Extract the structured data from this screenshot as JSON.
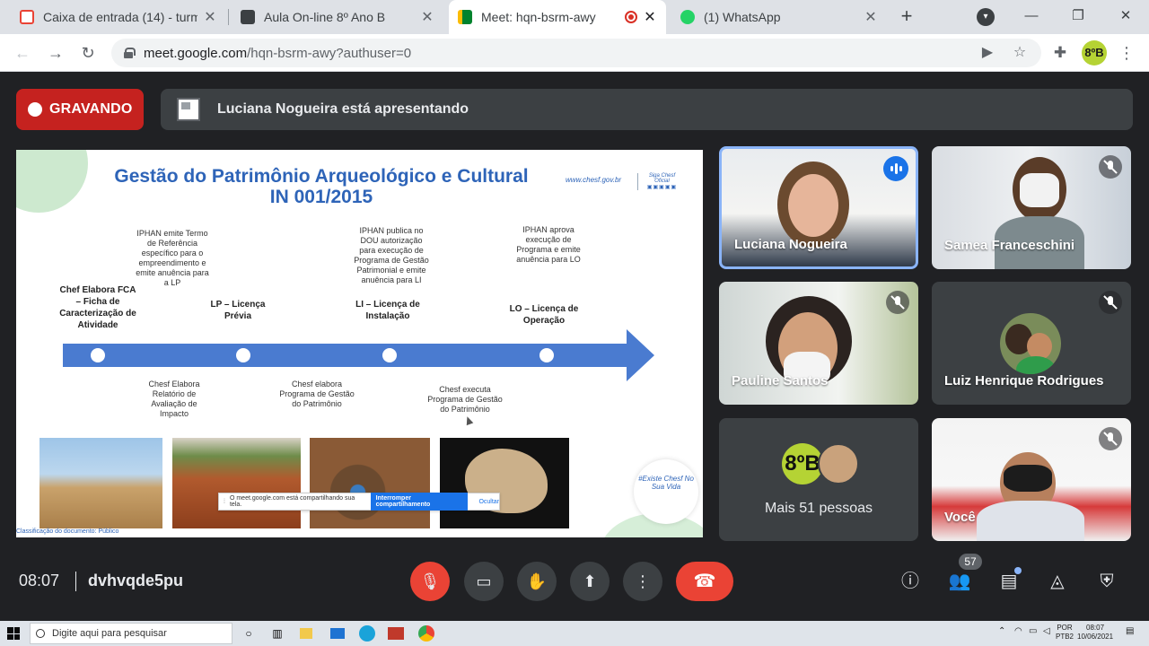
{
  "browser": {
    "tabs": [
      {
        "title": "Caixa de entrada (14) - turm",
        "favicon": "gmail-icon",
        "color": "#ea4335"
      },
      {
        "title": "Aula On-line 8º Ano B",
        "favicon": "classroom-icon",
        "color": "#3c4043"
      },
      {
        "title": "Meet: hqn-bsrm-awy",
        "favicon": "meet-icon",
        "color": "#00832d"
      },
      {
        "title": "(1) WhatsApp",
        "favicon": "whatsapp-icon",
        "color": "#25d366"
      }
    ],
    "new_tab": "+",
    "url_host": "meet.google.com",
    "url_path": "/hqn-bsrm-awy?authuser=0",
    "profile_label": "8ºB",
    "win_min": "—",
    "win_max": "❐",
    "win_close": "✕"
  },
  "meet": {
    "recording_label": "GRAVANDO",
    "presenting_label": "Luciana Nogueira está apresentando",
    "time": "08:07",
    "meeting_code": "dvhvqde5pu",
    "people_count": "57"
  },
  "slide": {
    "title_line1": "Gestão do Patrimônio Arqueológico e Cultural",
    "title_line2": "IN 001/2015",
    "website": "www.chesf.gov.br",
    "siga": "Siga Chesf Oficial",
    "siga_icons": "▣▣▣▣▣",
    "top_notes": [
      "IPHAN emite Termo de Referência específico para o empreendimento e emite anuência para a LP",
      "IPHAN publica no DOU autorização para execução de Programa de Gestão Patrimonial e emite anuência para LI",
      "IPHAN aprova execução de Programa e emite anuência para LO"
    ],
    "stages": [
      "Chef Elabora FCA – Ficha de Caracterização de Atividade",
      "LP – Licença Prévia",
      "LI – Licença de Instalação",
      "LO – Licença de Operação"
    ],
    "bottom_notes": [
      "Chesf Elabora Relatório de Avaliação de Impacto",
      "Chesf elabora Programa de Gestão do Patrimônio",
      "Chesf executa Programa de Gestão do Patrimônio"
    ],
    "classification": "Classificação do documento: Público",
    "badge": "#Existe Chesf No Sua Vida",
    "share_text": "O meet.google.com está compartilhando sua tela.",
    "share_stop": "Interromper compartilhamento",
    "share_hide": "Ocultar"
  },
  "participants": [
    {
      "name": "Luciana Nogueira"
    },
    {
      "name": "Samea Franceschini"
    },
    {
      "name": "Pauline Santos"
    },
    {
      "name": "Luiz Henrique Rodrigues"
    },
    {
      "name": "Você"
    }
  ],
  "more_people": {
    "label": "Mais 51 pessoas",
    "avatar_text": "8ºB"
  },
  "taskbar": {
    "search_placeholder": "Digite aqui para pesquisar",
    "lang_line1": "POR",
    "lang_line2": "PTB2",
    "clock_time": "08:07",
    "clock_date": "10/06/2021"
  }
}
